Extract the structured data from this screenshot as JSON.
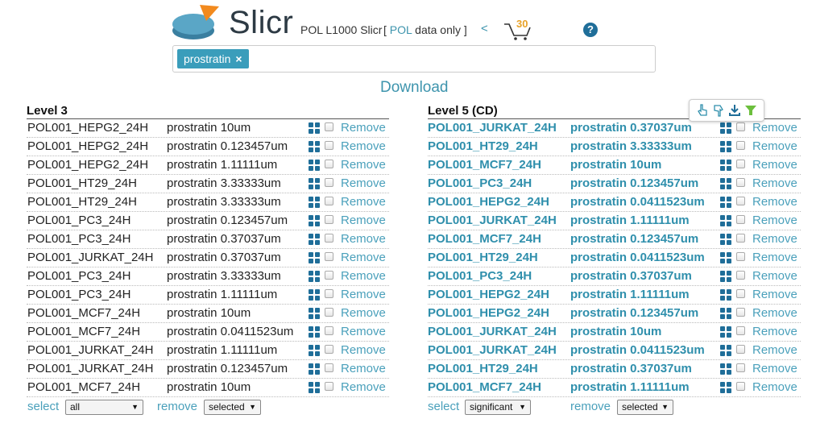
{
  "header": {
    "brand": "Slicr",
    "subtitle_prefix": "POL L1000 Slicr",
    "note_open": "[ ",
    "note_pol": "POL",
    "note_rest": " data only ]",
    "back": "<",
    "cart_count": "30",
    "help": "?"
  },
  "search": {
    "tag": "prostratin",
    "tag_remove": "×"
  },
  "download": "Download",
  "colors": {
    "accent": "#3d94ad",
    "tag": "#3a9dbb",
    "grid": "#1f6e99",
    "cart_count": "#e8a228"
  },
  "level3": {
    "title": "Level 3",
    "remove_label": "Remove",
    "rows": [
      {
        "id": "POL001_HEPG2_24H",
        "drug": "prostratin 10um"
      },
      {
        "id": "POL001_HEPG2_24H",
        "drug": "prostratin 0.123457um"
      },
      {
        "id": "POL001_HEPG2_24H",
        "drug": "prostratin 1.11111um"
      },
      {
        "id": "POL001_HT29_24H",
        "drug": "prostratin 3.33333um"
      },
      {
        "id": "POL001_HT29_24H",
        "drug": "prostratin 3.33333um"
      },
      {
        "id": "POL001_PC3_24H",
        "drug": "prostratin 0.123457um"
      },
      {
        "id": "POL001_PC3_24H",
        "drug": "prostratin 0.37037um"
      },
      {
        "id": "POL001_JURKAT_24H",
        "drug": "prostratin 0.37037um"
      },
      {
        "id": "POL001_PC3_24H",
        "drug": "prostratin 3.33333um"
      },
      {
        "id": "POL001_PC3_24H",
        "drug": "prostratin 1.11111um"
      },
      {
        "id": "POL001_MCF7_24H",
        "drug": "prostratin 10um"
      },
      {
        "id": "POL001_MCF7_24H",
        "drug": "prostratin 0.0411523um"
      },
      {
        "id": "POL001_JURKAT_24H",
        "drug": "prostratin 1.11111um"
      },
      {
        "id": "POL001_JURKAT_24H",
        "drug": "prostratin 0.123457um"
      },
      {
        "id": "POL001_MCF7_24H",
        "drug": "prostratin 10um"
      }
    ],
    "footer": {
      "select_label": "select",
      "select_value": "all",
      "remove_label": "remove",
      "remove_value": "selected"
    }
  },
  "level5": {
    "title": "Level 5 (CD)",
    "remove_label": "Remove",
    "rows": [
      {
        "id": "POL001_JURKAT_24H",
        "drug": "prostratin 0.37037um"
      },
      {
        "id": "POL001_HT29_24H",
        "drug": "prostratin 3.33333um"
      },
      {
        "id": "POL001_MCF7_24H",
        "drug": "prostratin 10um"
      },
      {
        "id": "POL001_PC3_24H",
        "drug": "prostratin 0.123457um"
      },
      {
        "id": "POL001_HEPG2_24H",
        "drug": "prostratin 0.0411523um"
      },
      {
        "id": "POL001_JURKAT_24H",
        "drug": "prostratin 1.11111um"
      },
      {
        "id": "POL001_MCF7_24H",
        "drug": "prostratin 0.123457um"
      },
      {
        "id": "POL001_HT29_24H",
        "drug": "prostratin 0.0411523um"
      },
      {
        "id": "POL001_PC3_24H",
        "drug": "prostratin 0.37037um"
      },
      {
        "id": "POL001_HEPG2_24H",
        "drug": "prostratin 1.11111um"
      },
      {
        "id": "POL001_HEPG2_24H",
        "drug": "prostratin 0.123457um"
      },
      {
        "id": "POL001_JURKAT_24H",
        "drug": "prostratin 10um"
      },
      {
        "id": "POL001_JURKAT_24H",
        "drug": "prostratin 0.0411523um"
      },
      {
        "id": "POL001_HT29_24H",
        "drug": "prostratin 0.37037um"
      },
      {
        "id": "POL001_MCF7_24H",
        "drug": "prostratin 1.11111um"
      }
    ],
    "footer": {
      "select_label": "select",
      "select_value": "significant",
      "remove_label": "remove",
      "remove_value": "selected"
    }
  },
  "toolbar": {
    "icons": [
      "hand-pointer-up-icon",
      "hand-pointer-down-icon",
      "download-icon",
      "filter-icon"
    ]
  }
}
